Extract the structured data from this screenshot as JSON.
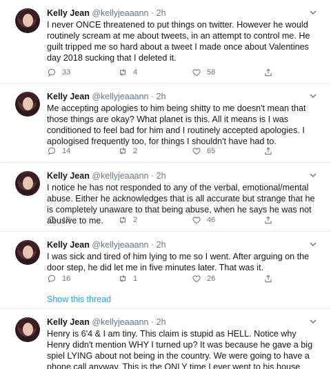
{
  "author": {
    "name": "Kelly Jean",
    "handle": "@kellyjeaaann",
    "dot": "·",
    "time": "2h"
  },
  "tweets": [
    {
      "text": "I never ONCE threatened to put things on twitter. However he would routinely scream at me about tweets, in an attempt to control  me. He guilt tripped me so hard about a tweet I made once about Valentines day 2018 sucking that I deleted it.",
      "replies": "33",
      "retweets": "4",
      "likes": "58"
    },
    {
      "text": "Me accepting apologies to him being shitty to me doesn't mean that those things are okay? What planet is this. All it means is I was conditioned to feel bad for him and I routinely accepted apologies. I apologised frequently too, for things I shouldn't have had to.",
      "replies": "14",
      "retweets": "2",
      "likes": "65"
    },
    {
      "text": "I notice he has not responded to any of the verbal, emotional/mental abuse. Either he acknowledges that is all accurate but strange that he is completely unaware to that being abuse, when he says he was not abusive to me.",
      "replies": "19",
      "retweets": "2",
      "likes": "46"
    },
    {
      "text": "I was sick and tired of him lying to me so I went. After arguing on the door step, he did let me in five minutes later. That was it.",
      "replies": "16",
      "retweets": "1",
      "likes": "26"
    },
    {
      "text": "Henry is 6'4 & I am tiny. This claim is stupid as HELL. Notice why Henry didn't mention WHY I turned up? It was because he gave a big spiel LYING about not being in the country. We were going to have a phone call anyway. This is the ONLY time I ever went to his house unannounced."
    }
  ],
  "show_thread_label": "Show this thread",
  "colors": {
    "link": "#1da1f2",
    "muted": "#657786",
    "text": "#14171a",
    "divider": "#e6ecf0"
  }
}
